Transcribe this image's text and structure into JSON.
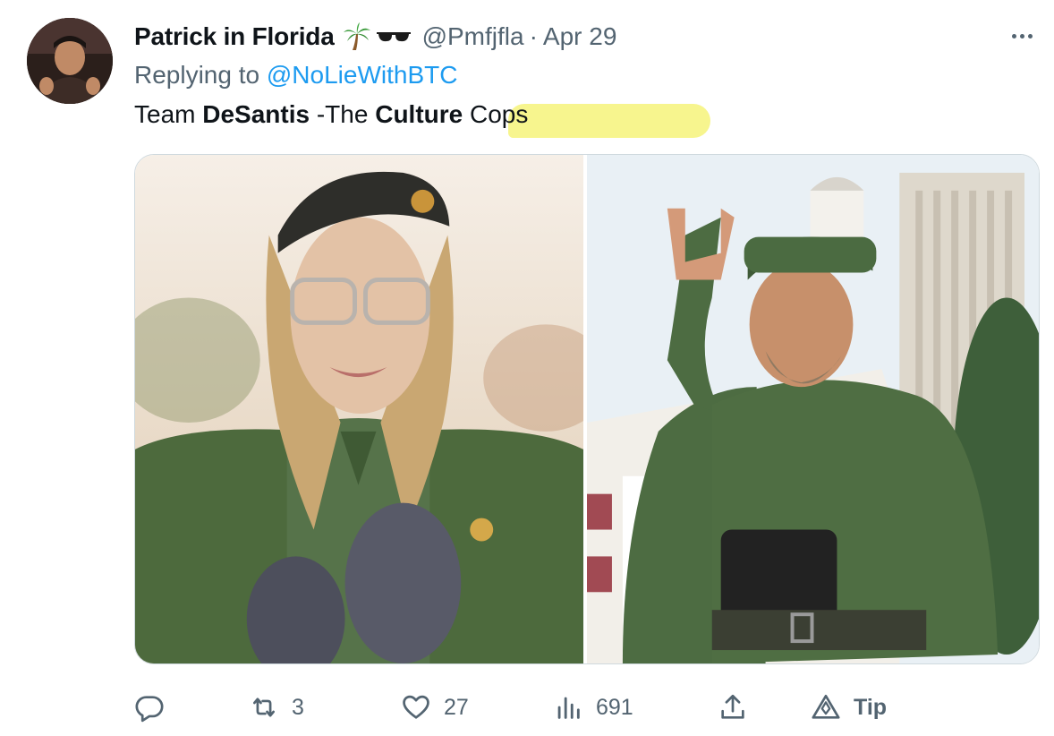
{
  "author": {
    "display_name": "Patrick in Florida",
    "emoji": [
      "palm-tree",
      "sunglasses"
    ],
    "handle": "@Pmfjfla",
    "separator": "·",
    "date": "Apr 29"
  },
  "reply": {
    "prefix": "Replying to",
    "target": "@NoLieWithBTC"
  },
  "tweet": {
    "part1": "Team ",
    "bold1": "DeSantis",
    "part2": " -The ",
    "bold2": "Culture",
    "part3": " Cops"
  },
  "media": {
    "images": [
      "woman-in-military-uniform-beret",
      "man-in-military-uniform-waving"
    ]
  },
  "actions": {
    "reply_count": "",
    "retweet_count": "3",
    "like_count": "27",
    "view_count": "691",
    "tip_label": "Tip"
  },
  "colors": {
    "text": "#0f1419",
    "secondary": "#536471",
    "link": "#1d9bf0",
    "highlight": "#f7f58e",
    "border": "#cfd9de"
  }
}
